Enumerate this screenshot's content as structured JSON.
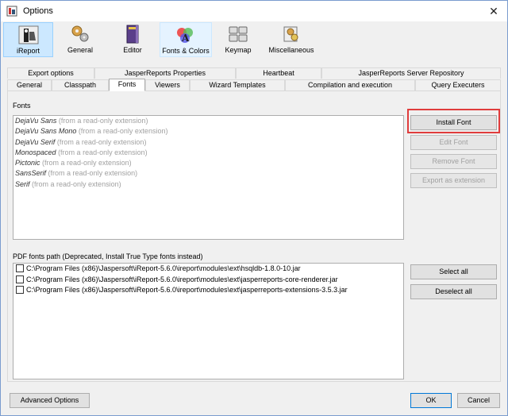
{
  "window": {
    "title": "Options",
    "close_glyph": "✕"
  },
  "toolbar": {
    "items": [
      {
        "label": "iReport",
        "icon": "ireport-icon",
        "selected": true
      },
      {
        "label": "General",
        "icon": "gears-icon"
      },
      {
        "label": "Editor",
        "icon": "editor-book-icon"
      },
      {
        "label": "Fonts & Colors",
        "icon": "fonts-colors-icon",
        "hover": true
      },
      {
        "label": "Keymap",
        "icon": "keyboard-icon"
      },
      {
        "label": "Miscellaneous",
        "icon": "misc-gears-icon"
      }
    ]
  },
  "tabs": {
    "row1": [
      "Export options",
      "JasperReports Properties",
      "Heartbeat",
      "JasperReports Server Repository"
    ],
    "row2": [
      "General",
      "Classpath",
      "Fonts",
      "Viewers",
      "Wizard Templates",
      "Compilation and execution",
      "Query Executers"
    ],
    "active": "Fonts"
  },
  "fonts": {
    "label": "Fonts",
    "items": [
      {
        "name": "DejaVu Sans",
        "note": "(from a read-only extension)"
      },
      {
        "name": "DejaVu Sans Mono",
        "note": "(from a read-only extension)"
      },
      {
        "name": "DejaVu Serif",
        "note": "(from a read-only extension)"
      },
      {
        "name": "Monospaced",
        "note": "(from a read-only extension)"
      },
      {
        "name": "Pictonic",
        "note": "(from a read-only extension)"
      },
      {
        "name": "SansSerif",
        "note": "(from a read-only extension)"
      },
      {
        "name": "Serif",
        "note": "(from a read-only extension)"
      }
    ],
    "buttons": {
      "install": "Install Font",
      "edit": "Edit Font",
      "remove": "Remove Font",
      "export": "Export as extension"
    }
  },
  "pdf": {
    "label": "PDF fonts path (Deprecated, Install True Type fonts instead)",
    "paths": [
      "C:\\Program Files (x86)\\Jaspersoft\\iReport-5.6.0\\ireport\\modules\\ext\\hsqldb-1.8.0-10.jar",
      "C:\\Program Files (x86)\\Jaspersoft\\iReport-5.6.0\\ireport\\modules\\ext\\jasperreports-core-renderer.jar",
      "C:\\Program Files (x86)\\Jaspersoft\\iReport-5.6.0\\ireport\\modules\\ext\\jasperreports-extensions-3.5.3.jar"
    ],
    "buttons": {
      "select_all": "Select all",
      "deselect_all": "Deselect all"
    }
  },
  "footer": {
    "advanced": "Advanced Options",
    "ok": "OK",
    "cancel": "Cancel"
  },
  "colors": {
    "selection": "#cce8ff",
    "highlight_box": "#e03c3c",
    "default_button_border": "#0078d7"
  }
}
